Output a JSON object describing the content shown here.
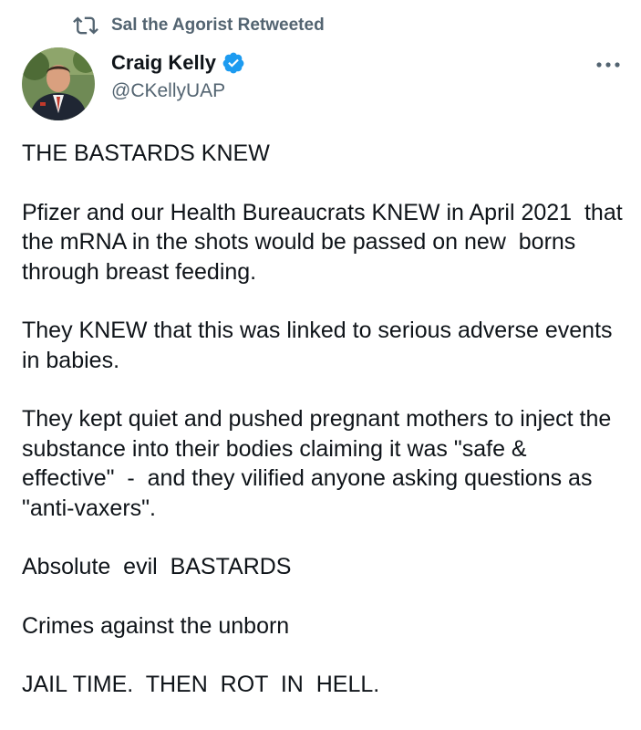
{
  "retweet": {
    "label": "Sal the Agorist Retweeted",
    "icon": "retweet-icon"
  },
  "author": {
    "name": "Craig Kelly",
    "handle": "@CKellyUAP",
    "verified": true,
    "verified_icon": "verified-badge-icon",
    "avatar": "avatar-photo"
  },
  "menu_icon": "more-options-icon",
  "colors": {
    "text": "#0f1419",
    "secondary": "#536471",
    "verified": "#1d9bf0"
  },
  "tweet": {
    "paragraphs": [
      "THE BASTARDS KNEW",
      "Pfizer and our Health Bureaucrats KNEW in April 2021  that the mRNA in the shots would be passed on new  borns through breast feeding.",
      "They KNEW that this was linked to serious adverse events in babies.",
      "They kept quiet and pushed pregnant mothers to inject the substance into their bodies claiming it was \"safe & effective\"  -  and they vilified anyone asking questions as  \"anti-vaxers\".",
      "Absolute  evil  BASTARDS",
      "Crimes against the unborn",
      "JAIL TIME.  THEN  ROT  IN  HELL."
    ]
  }
}
